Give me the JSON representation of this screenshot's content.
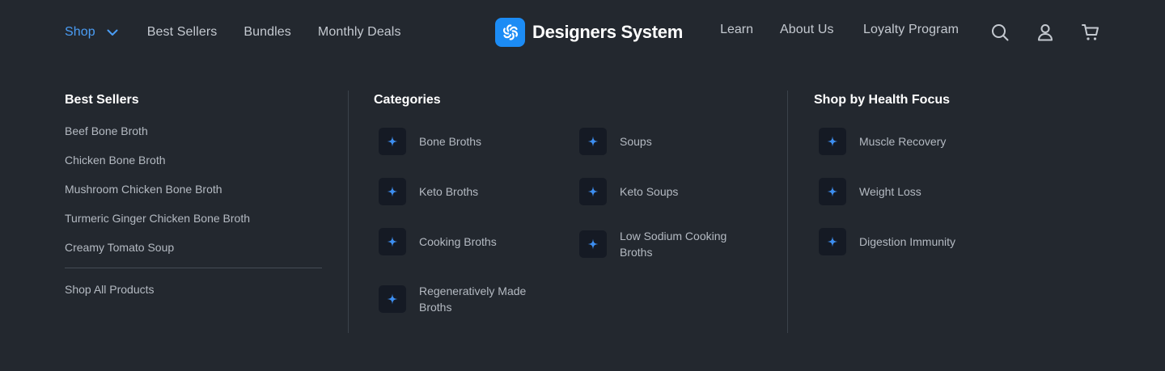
{
  "header": {
    "shop_label": "Shop",
    "nav_left": [
      "Best Sellers",
      "Bundles",
      "Monthly Deals"
    ],
    "brand_name": "Designers System",
    "nav_right": {
      "learn_label": "Learn",
      "about_label": "About Us",
      "loyalty_label": "Loyalty Program"
    },
    "icons": [
      "search-icon",
      "user-icon",
      "cart-icon"
    ],
    "accent_color": "#4a9df5"
  },
  "menu": {
    "best_sellers": {
      "title": "Best Sellers",
      "items": [
        "Beef Bone Broth",
        "Chicken Bone Broth",
        "Mushroom Chicken Bone Broth",
        "Turmeric Ginger Chicken Bone Broth",
        "Creamy Tomato Soup"
      ],
      "shop_all": "Shop All Products"
    },
    "categories": {
      "title": "Categories",
      "items": [
        "Bone Broths",
        "Soups",
        "Keto Broths",
        "Keto Soups",
        "Cooking Broths",
        "Low Sodium Cooking Broths",
        "Regeneratively Made Broths"
      ]
    },
    "health": {
      "title": "Shop by Health Focus",
      "items": [
        "Muscle Recovery",
        "Weight Loss",
        "Digestion Immunity"
      ]
    },
    "item_icon": "sparkle-icon"
  }
}
